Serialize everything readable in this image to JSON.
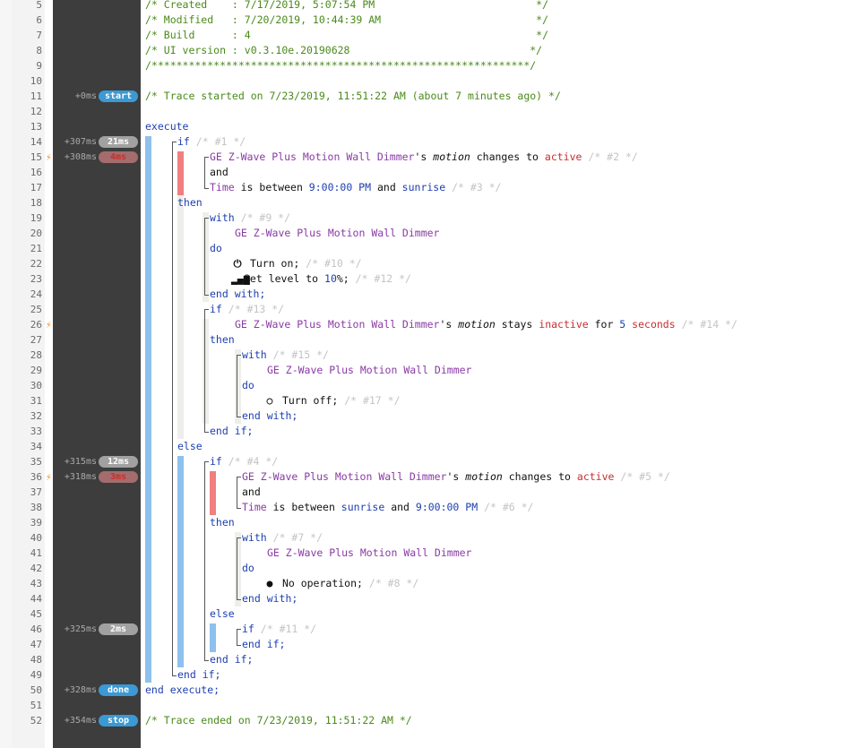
{
  "line_numbers": [
    "5",
    "6",
    "7",
    "8",
    "9",
    "10",
    "11",
    "12",
    "13",
    "14",
    "15",
    "16",
    "17",
    "18",
    "19",
    "20",
    "21",
    "22",
    "23",
    "24",
    "25",
    "26",
    "27",
    "28",
    "29",
    "30",
    "31",
    "32",
    "33",
    "34",
    "35",
    "36",
    "37",
    "38",
    "39",
    "40",
    "41",
    "42",
    "43",
    "44",
    "45",
    "46",
    "47",
    "48",
    "49",
    "50",
    "51",
    "52"
  ],
  "header_comments": {
    "created": "/* Created    : 7/17/2019, 5:07:54 PM                          */",
    "modified": "/* Modified   : 7/20/2019, 10:44:39 AM                         */",
    "build": "/* Build      : 4                                              */",
    "ui_version": "/* UI version : v0.3.10e.20190628                             */",
    "stars": "/*************************************************************/",
    "trace_start": "/* Trace started on 7/23/2019, 11:51:22 AM (about 7 minutes ago) */",
    "trace_end": "/* Trace ended on 7/23/2019, 11:51:22 AM */"
  },
  "timings": [
    {
      "line": "11",
      "offset": "+0ms",
      "pill": "start",
      "kind": "state"
    },
    {
      "line": "14",
      "offset": "+307ms",
      "pill": "21ms",
      "kind": "dur"
    },
    {
      "line": "15",
      "offset": "+308ms",
      "pill": "4ms",
      "kind": "dur-red"
    },
    {
      "line": "35",
      "offset": "+315ms",
      "pill": "12ms",
      "kind": "dur"
    },
    {
      "line": "36",
      "offset": "+318ms",
      "pill": "3ms",
      "kind": "dur-red"
    },
    {
      "line": "46",
      "offset": "+325ms",
      "pill": "2ms",
      "kind": "dur"
    },
    {
      "line": "50",
      "offset": "+328ms",
      "pill": "done",
      "kind": "state"
    },
    {
      "line": "52",
      "offset": "+354ms",
      "pill": "stop",
      "kind": "state"
    }
  ],
  "code": {
    "execute": "execute",
    "end_execute": "end execute;",
    "if": "if",
    "then": "then",
    "else": "else",
    "and": "and",
    "with": "with",
    "do": "do",
    "end_with": "end with;",
    "end_if": "end if;",
    "device": "GE Z-Wave Plus Motion Wall Dimmer",
    "device_poss": "GE Z-Wave Plus Motion Wall Dimmer",
    "apos_s": "'s ",
    "motion": "motion",
    "changes_to": " changes to ",
    "stays": " stays ",
    "active": "active",
    "inactive": "inactive",
    "for": " for ",
    "five": "5",
    "seconds": "seconds",
    "time": "Time",
    "is_between": " is between ",
    "t9pm": "9:00:00 PM",
    "sunrise": "sunrise",
    "and_sp": " and ",
    "turn_on": "Turn on;",
    "set_level": "Set level to ",
    "level_val": "10",
    "level_pct": "%;",
    "turn_off": "Turn off;",
    "no_op": "No operation;",
    "c1": "/* #1 */",
    "c2": "/* #2 */",
    "c3": "/* #3 */",
    "c4": "/* #4 */",
    "c5": "/* #5 */",
    "c6": "/* #6 */",
    "c7": "/* #7 */",
    "c8": "/* #8 */",
    "c9": "/* #9 */",
    "c10": "/* #10 */",
    "c11": "/* #11 */",
    "c12": "/* #12 */",
    "c13": "/* #13 */",
    "c14": "/* #14 */",
    "c15": "/* #15 */",
    "c17": "/* #17 */"
  },
  "icons": {
    "power": "power-icon",
    "level": "signal-bars-icon",
    "off": "circle-outline-icon",
    "noop": "filled-circle-icon",
    "bolt": "lightning-bolt-icon"
  },
  "colors": {
    "gutter": "#3d3d3d",
    "comment": "#4a8a1a",
    "keyword": "#1d3fb0",
    "device": "#8a3aa5",
    "active": "#c92e2e",
    "pill_blue": "#3b99d4",
    "pill_gray": "#a1a1a1",
    "pill_red": "#a46c6c",
    "bar_blue": "#8ec1ee",
    "bar_red": "#f17f7f"
  }
}
